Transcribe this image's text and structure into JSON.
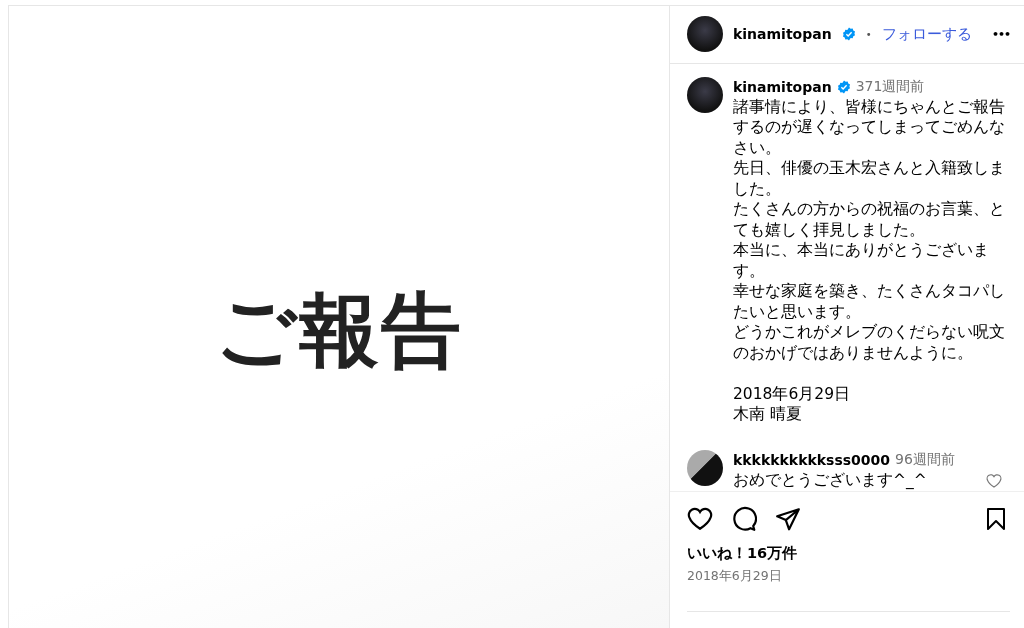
{
  "post_image": {
    "text": "ご報告"
  },
  "header": {
    "username": "kinamitopan",
    "verified": true,
    "separator": "•",
    "follow": "フォローする",
    "more": "•••"
  },
  "caption": {
    "username": "kinamitopan",
    "verified": true,
    "time": "371週間前",
    "paragraphs": [
      "諸事情により、皆様にちゃんとご報告するのが遅くなってしまってごめんなさい。",
      "先日、俳優の玉木宏さんと入籍致しました。",
      "たくさんの方からの祝福のお言葉、とても嬉しく拝見しました。",
      "本当に、本当にありがとうございます。",
      "幸せな家庭を築き、たくさんタコパしたいと思います。",
      "どうかこれがメレブのくだらない呪文のおかげではありませんように。"
    ],
    "signature": [
      "2018年6月29日",
      "木南 晴夏"
    ]
  },
  "comments": [
    {
      "username": "kkkkkkkkkksss0000",
      "time": "96週間前",
      "text": "おめでとうございます^_^",
      "liked": false
    }
  ],
  "likes": "いいね！16万件",
  "date": "2018年6月29日"
}
